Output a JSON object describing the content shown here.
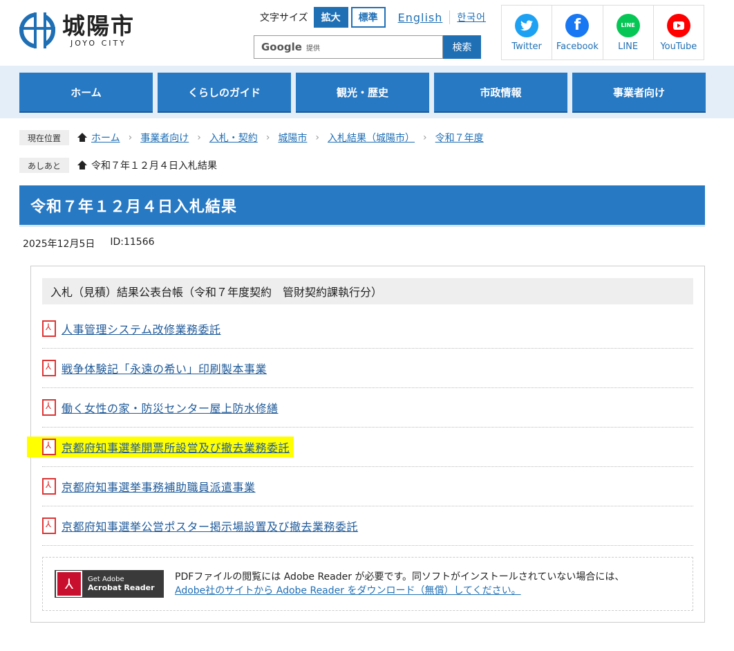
{
  "header": {
    "logo_ja": "城陽市",
    "logo_en": "JOYO CITY",
    "text_size_label": "文字サイズ",
    "size_large": "拡大",
    "size_normal": "標準",
    "lang_en": "English",
    "lang_ko": "한국어",
    "search_provider": "Google",
    "search_provider_sub": "提供",
    "search_button": "検索"
  },
  "sns": [
    {
      "label": "Twitter",
      "color": "#1da1f2",
      "icon": "twitter-icon"
    },
    {
      "label": "Facebook",
      "color": "#1877f2",
      "icon": "facebook-icon"
    },
    {
      "label": "LINE",
      "color": "#06c755",
      "icon": "line-icon"
    },
    {
      "label": "YouTube",
      "color": "#ff0000",
      "icon": "youtube-icon"
    }
  ],
  "nav": [
    "ホーム",
    "くらしのガイド",
    "観光・歴史",
    "市政情報",
    "事業者向け"
  ],
  "breadcrumb": {
    "tag": "現在位置",
    "items": [
      "ホーム",
      "事業者向け",
      "入札・契約",
      "城陽市",
      "入札結果（城陽市）",
      "令和７年度"
    ]
  },
  "footprint": {
    "tag": "あしあと",
    "current": "令和７年１２月４日入札結果"
  },
  "page": {
    "title": "令和７年１２月４日入札結果",
    "date": "2025年12月5日",
    "id": "ID:11566"
  },
  "box": {
    "heading": "入札（見積）結果公表台帳（令和７年度契約　管財契約課執行分）",
    "documents": [
      "人事管理システム改修業務委託",
      "戦争体験記「永遠の希い」印刷製本事業",
      "働く女性の家・防災センター屋上防水修繕",
      "京都府知事選挙開票所設営及び撤去業務委託",
      "京都府知事選挙事務補助職員派遣事業",
      "京都府知事選挙公営ポスター掲示場設置及び撤去業務委託"
    ],
    "highlight_color": "#ffff00"
  },
  "adobe": {
    "badge_line1": "Get Adobe",
    "badge_line2": "Acrobat Reader",
    "text": "PDFファイルの閲覧には Adobe Reader が必要です。同ソフトがインストールされていない場合には、",
    "link": "Adobe社のサイトから Adobe Reader をダウンロード（無償）してください。"
  },
  "colors": {
    "accent": "#2779c4",
    "link": "#1f6fb5"
  }
}
